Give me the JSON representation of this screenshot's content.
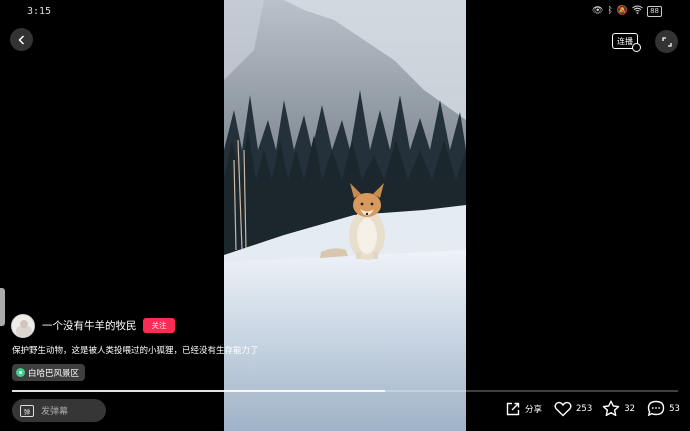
{
  "status_bar": {
    "time": "3:15",
    "icons": [
      "eye-icon",
      "bluetooth-icon",
      "mute-icon",
      "wifi-icon"
    ],
    "battery": "88"
  },
  "top_bar": {
    "lianbo_label": "连播"
  },
  "author": {
    "name": "一个没有牛羊的牧民",
    "follow_label": "关注"
  },
  "caption": "保护野生动物，这是被人类投喂过的小狐狸，已经没有生存能力了",
  "location": "白哈巴风景区",
  "progress": 0.56,
  "bottom_bar": {
    "danmu_icon_label": "弹",
    "danmu_placeholder": "发弹幕",
    "share_label": "分享",
    "like_count": "253",
    "favorite_count": "32",
    "comment_count": "53"
  },
  "colors": {
    "follow": "#fe2c55",
    "background": "#000000"
  }
}
